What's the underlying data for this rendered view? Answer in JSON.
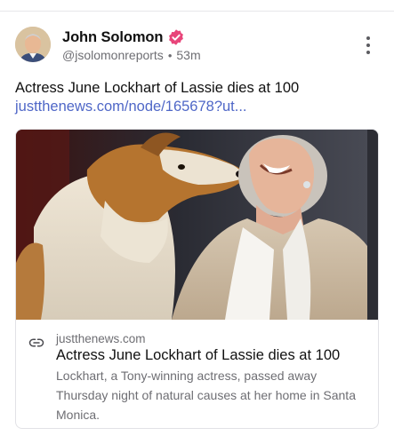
{
  "author": {
    "display_name": "John Solomon",
    "handle": "@jsolomonreports",
    "timestamp": "53m",
    "verified_badge_color": "#e8457a"
  },
  "post": {
    "text": "Actress June Lockhart of Lassie dies at 100",
    "link_text": "justthenews.com/node/165678?ut..."
  },
  "link_card": {
    "domain": "justthenews.com",
    "title": "Actress June Lockhart of Lassie dies at 100",
    "description": "Lockhart, a Tony-winning actress, passed away Thursday night of natural causes at her home in Santa Monica."
  },
  "icons": {
    "more": "more-vertical-icon",
    "link": "link-icon",
    "verified": "verified-badge-icon"
  },
  "colors": {
    "link": "#4f67c7",
    "secondary_text": "#6e6e73",
    "badge": "#e8457a"
  }
}
